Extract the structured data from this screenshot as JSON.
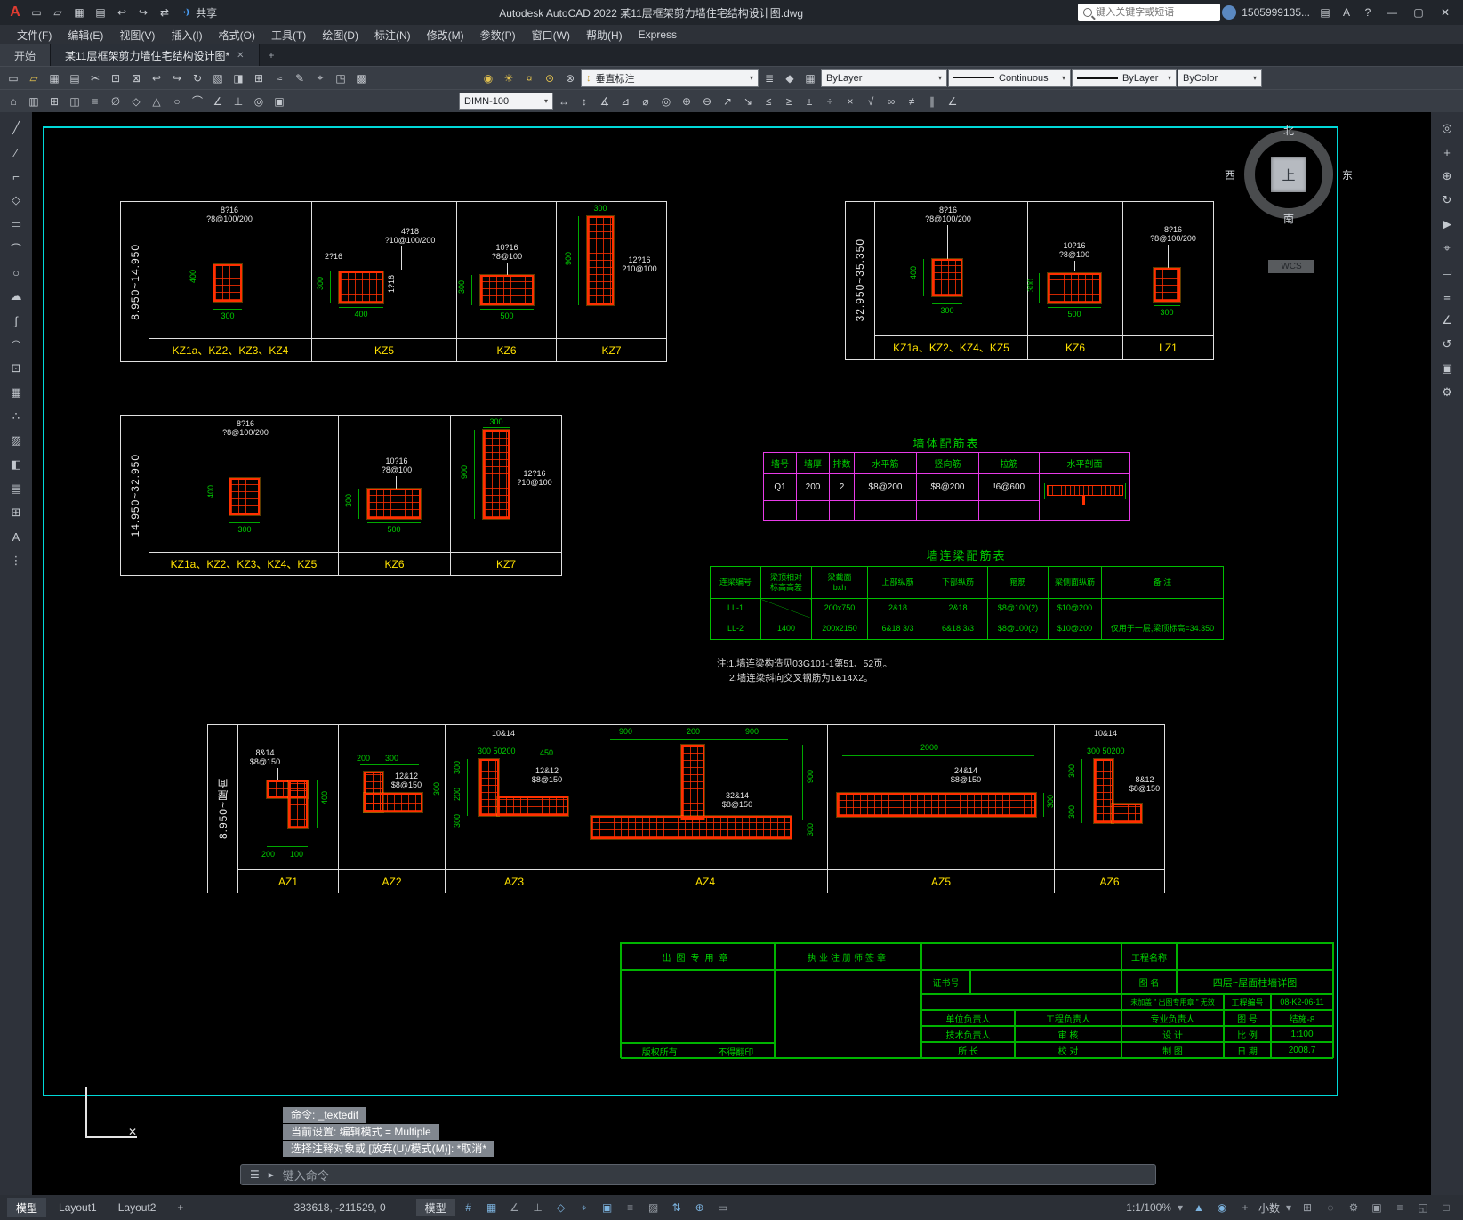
{
  "ui": {
    "caret": "▾"
  },
  "titlebar": {
    "logo": "A",
    "quick": [
      "▭",
      "▱",
      "▦",
      "▤",
      "↩",
      "↪",
      "⇄"
    ],
    "share_plane": "✈",
    "share": "共享",
    "title": "Autodesk AutoCAD 2022    某11层框架剪力墙住宅结构设计图.dwg",
    "search_placeholder": "键入关键字或短语",
    "account": "1505999135...",
    "cart": "▤",
    "apps": "A",
    "help": "?",
    "min": "—",
    "max": "▢",
    "close": "✕"
  },
  "menubar": {
    "items": [
      "文件(F)",
      "编辑(E)",
      "视图(V)",
      "插入(I)",
      "格式(O)",
      "工具(T)",
      "绘图(D)",
      "标注(N)",
      "修改(M)",
      "参数(P)",
      "窗口(W)",
      "帮助(H)",
      "Express"
    ]
  },
  "tabs": {
    "start": "开始",
    "drawing": "某11层框架剪力墙住宅结构设计图*",
    "close": "✕",
    "add": "+"
  },
  "toolbar1": {
    "icons": [
      "▭",
      "▱",
      "▦",
      "▤",
      "✂",
      "⊡",
      "⊠",
      "↩",
      "↪",
      "↻",
      "▧",
      "◨",
      "⊞",
      "≈",
      "✎",
      "⌖",
      "◳",
      "▩"
    ],
    "bulbs": [
      "◉",
      "☀",
      "¤",
      "⊙",
      "⊗"
    ],
    "style_icon": "↕",
    "style_combo": "垂直标注",
    "layer_icons": [
      "≣",
      "◆",
      "▦"
    ],
    "layer_combo": "ByLayer",
    "linetype_combo": "Continuous",
    "lineweight_combo": "ByLayer",
    "plotstyle_combo": "ByColor"
  },
  "toolbar2": {
    "icons_a": [
      "⌂",
      "▥",
      "⊞",
      "◫",
      "≡",
      "∅",
      "◇",
      "△",
      "○",
      "⌒",
      "∠",
      "⊥",
      "◎",
      "▣"
    ],
    "dim_combo": "DIMN-100",
    "icons_b": [
      "↔",
      "↕",
      "∡",
      "⊿",
      "⌀",
      "◎",
      "⊕",
      "⊖",
      "↗",
      "↘",
      "≤",
      "≥",
      "±",
      "÷",
      "×",
      "√",
      "∞",
      "≠",
      "∥",
      "∠"
    ]
  },
  "left_dock": [
    "╱",
    "∕",
    "⌐",
    "◇",
    "▭",
    "⌒",
    "○",
    "☁",
    "∫",
    "◠",
    "⊡",
    "▦",
    "∴",
    "▨",
    "◧",
    "▤",
    "⊞",
    "A",
    "⋮"
  ],
  "right_dock": [
    "◎",
    "+",
    "⊕",
    "↻",
    "▶",
    "⌖",
    "▭",
    "≡",
    "∠",
    "↺",
    "▣",
    "⚙"
  ],
  "g1": {
    "range": "8.950~14.950",
    "c1": {
      "label": "KZ1a、KZ2、KZ3、KZ4",
      "r1": "8?16",
      "r2": "?8@100/200",
      "dl": "400",
      "db": "300"
    },
    "c2": {
      "label": "KZ5",
      "a1": "2?16",
      "r1": "4?18",
      "r2": "?10@100/200",
      "a2": "1?16",
      "dl": "300",
      "db": "400"
    },
    "c3": {
      "label": "KZ6",
      "r1": "10?16",
      "r2": "?8@100",
      "dl": "300",
      "db": "500"
    },
    "c4": {
      "label": "KZ7",
      "r1": "12?16",
      "r2": "?10@100",
      "dl": "900",
      "dt": "300"
    }
  },
  "g2": {
    "range": "32.950~35.350",
    "c1": {
      "label": "KZ1a、KZ2、KZ4、KZ5",
      "r1": "8?16",
      "r2": "?8@100/200",
      "dl": "400",
      "db": "300"
    },
    "c2": {
      "label": "KZ6",
      "r1": "10?16",
      "r2": "?8@100",
      "dl": "300",
      "db": "500"
    },
    "c3": {
      "label": "LZ1",
      "r1": "8?16",
      "r2": "?8@100/200",
      "db": "300"
    }
  },
  "g3": {
    "range": "14.950~32.950",
    "c1": {
      "label": "KZ1a、KZ2、KZ3、KZ4、KZ5",
      "r1": "8?16",
      "r2": "?8@100/200",
      "dl": "400",
      "db": "300"
    },
    "c2": {
      "label": "KZ6",
      "r1": "10?16",
      "r2": "?8@100",
      "dl": "300",
      "db": "500"
    },
    "c3": {
      "label": "KZ7",
      "r1": "12?16",
      "r2": "?10@100",
      "dl": "900",
      "dt": "300"
    }
  },
  "g4": {
    "range": "8.950~屋面",
    "c1": {
      "label": "AZ1",
      "r1": "8&14",
      "r2": "$8@150",
      "dr": "400",
      "db1": "200",
      "db2": "100"
    },
    "c2": {
      "label": "AZ2",
      "dt1": "200",
      "dt2": "300",
      "r1": "12&12",
      "r2": "$8@150",
      "dr": "300"
    },
    "c3": {
      "label": "AZ3",
      "t1": "10&14",
      "t2": "300 50200",
      "t3": "450",
      "r1": "12&12",
      "r2": "$8@150",
      "dl1": "300",
      "dl2": "200",
      "dl3": "300"
    },
    "c4": {
      "label": "AZ4",
      "dt1": "900",
      "dt2": "200",
      "dt3": "900",
      "r1": "32&14",
      "r2": "$8@150",
      "dr": "900",
      "db": "300"
    },
    "c5": {
      "label": "AZ5",
      "dt": "2000",
      "r1": "24&14",
      "r2": "$8@150",
      "dr": "300"
    },
    "c6": {
      "label": "AZ6",
      "t1": "10&14",
      "t2": "300 50200",
      "r1": "8&12",
      "r2": "$8@150",
      "dl1": "300",
      "dl2": "300"
    }
  },
  "wall_table": {
    "title": "墙体配筋表",
    "headers": [
      "墙号",
      "墙厚",
      "排数",
      "水平筋",
      "竖向筋",
      "拉筋",
      "水平剖面"
    ],
    "row": [
      "Q1",
      "200",
      "2",
      "$8@200",
      "$8@200",
      "!6@600"
    ]
  },
  "beam_table": {
    "title": "墙连梁配筋表",
    "headers": [
      "连梁编号",
      "梁顶相对\n标高高差",
      "梁截面\nbxh",
      "上部纵筋",
      "下部纵筋",
      "箍筋",
      "梁侧面纵筋",
      "备  注"
    ],
    "rows": [
      [
        "LL-1",
        "",
        "200x750",
        "2&18",
        "2&18",
        "$8@100(2)",
        "$10@200",
        ""
      ],
      [
        "LL-2",
        "1400",
        "200x2150",
        "6&18 3/3",
        "6&18 3/3",
        "$8@100(2)",
        "$10@200",
        "仅用于一层,梁顶标高=34.350"
      ]
    ],
    "notes": [
      "注:1.墙连梁构造见03G101-1第51、52页。",
      "2.墙连梁斜向交叉钢筋为1&14X2。"
    ]
  },
  "titleblock": {
    "stamp": "出图专用章",
    "sign": "执业注册师签章",
    "project": "工程名称",
    "cert": "证书号",
    "fig_label": "图  名",
    "fig_name": "四层~屋面柱墙详图",
    "invalid": "未加盖 \" 出图专用章 \" 无效",
    "projno_label": "工程编号",
    "projno": "08-K2-06-11",
    "a1": "单位负责人",
    "a2": "工程负责人",
    "a3": "专业负责人",
    "figno_label": "图  号",
    "figno": "结施-8",
    "b1": "技术负责人",
    "b2": "审  核",
    "b3": "设  计",
    "scale_label": "比  例",
    "scale": "1:100",
    "c1": "所  长",
    "c2": "校  对",
    "c3": "制  图",
    "date_label": "日  期",
    "date": "2008.7",
    "copy1": "版权所有",
    "copy2": "不得翻印"
  },
  "compass": {
    "n": "北",
    "s": "南",
    "w": "西",
    "e": "东",
    "top": "上",
    "wcs": "WCS"
  },
  "cmd": {
    "lines": [
      "命令: _textedit",
      "当前设置: 编辑模式 = Multiple",
      "选择注释对象或 [放弃(U)/模式(M)]: *取消*"
    ],
    "hint": "键入命令",
    "menu": "☰",
    "prompt": "▸",
    "ucs_x": "✕"
  },
  "statusbar": {
    "tabs": [
      "模型",
      "Layout1",
      "Layout2",
      "+"
    ],
    "coords": "383618, -211529, 0",
    "model_btn": "模型",
    "left_icons": [
      "#",
      "▦",
      "∠",
      "⊥",
      "◇",
      "⌖",
      "▣",
      "≡",
      "▨",
      "⇅",
      "⊕",
      "▭"
    ],
    "scale": "1:1/100%",
    "mid_icons": [
      "▲",
      "◉",
      "+"
    ],
    "units": "小数",
    "right_icons": [
      "⊞",
      "◌",
      "⚙",
      "▣",
      "≡",
      "◱",
      "□"
    ]
  }
}
